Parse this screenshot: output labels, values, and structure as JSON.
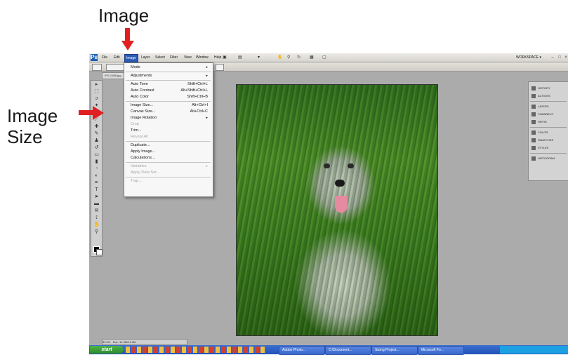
{
  "annotations": {
    "image_label": "Image",
    "image_size_line1": "Image",
    "image_size_line2": "Size",
    "arrow_color": "#e02020"
  },
  "menubar": {
    "logo": "Ps",
    "items": [
      "File",
      "Edit",
      "Image",
      "Layer",
      "Select",
      "Filter",
      "View",
      "Window",
      "Help"
    ],
    "active": "Image",
    "workspace_label": "WORKSPACE ▾"
  },
  "document": {
    "tab_label": "IPG-0456.jpg",
    "zoom": "33.3%",
    "doc_size": "Doc: 12.9M/12.9M"
  },
  "image_menu": [
    {
      "label": "Mode",
      "shortcut": "",
      "submenu": true,
      "disabled": false
    },
    {
      "separator": true
    },
    {
      "label": "Adjustments",
      "shortcut": "",
      "submenu": true,
      "disabled": false
    },
    {
      "separator": true
    },
    {
      "label": "Auto Tone",
      "shortcut": "Shift+Ctrl+L",
      "submenu": false,
      "disabled": false
    },
    {
      "label": "Auto Contrast",
      "shortcut": "Alt+Shift+Ctrl+L",
      "submenu": false,
      "disabled": false
    },
    {
      "label": "Auto Color",
      "shortcut": "Shift+Ctrl+B",
      "submenu": false,
      "disabled": false
    },
    {
      "separator": true
    },
    {
      "label": "Image Size...",
      "shortcut": "Alt+Ctrl+I",
      "submenu": false,
      "disabled": false
    },
    {
      "label": "Canvas Size...",
      "shortcut": "Alt+Ctrl+C",
      "submenu": false,
      "disabled": false
    },
    {
      "label": "Image Rotation",
      "shortcut": "",
      "submenu": true,
      "disabled": false
    },
    {
      "label": "Crop",
      "shortcut": "",
      "submenu": false,
      "disabled": true
    },
    {
      "label": "Trim...",
      "shortcut": "",
      "submenu": false,
      "disabled": false
    },
    {
      "label": "Reveal All",
      "shortcut": "",
      "submenu": false,
      "disabled": true
    },
    {
      "separator": true
    },
    {
      "label": "Duplicate...",
      "shortcut": "",
      "submenu": false,
      "disabled": false
    },
    {
      "label": "Apply Image...",
      "shortcut": "",
      "submenu": false,
      "disabled": false
    },
    {
      "label": "Calculations...",
      "shortcut": "",
      "submenu": false,
      "disabled": false
    },
    {
      "separator": true
    },
    {
      "label": "Variables",
      "shortcut": "",
      "submenu": true,
      "disabled": true
    },
    {
      "label": "Apply Data Set...",
      "shortcut": "",
      "submenu": false,
      "disabled": true
    },
    {
      "separator": true
    },
    {
      "label": "Trap...",
      "shortcut": "",
      "submenu": false,
      "disabled": true
    }
  ],
  "panels": [
    {
      "label": "HISTORY",
      "icon": "history-icon"
    },
    {
      "label": "ACTIONS",
      "icon": "actions-icon"
    },
    {
      "separator": true
    },
    {
      "label": "LAYERS",
      "icon": "layers-icon"
    },
    {
      "label": "CHANNELS",
      "icon": "channels-icon"
    },
    {
      "label": "PATHS",
      "icon": "paths-icon"
    },
    {
      "separator": true
    },
    {
      "label": "COLOR",
      "icon": "color-icon"
    },
    {
      "label": "SWATCHES",
      "icon": "swatches-icon"
    },
    {
      "label": "STYLES",
      "icon": "styles-icon"
    },
    {
      "separator": true
    },
    {
      "label": "HISTOGRAM",
      "icon": "histogram-icon"
    }
  ],
  "taskbar": {
    "start_label": "start",
    "buttons": [
      "Adobe Photo...",
      "C:\\Document...",
      "Sizing Project...",
      "Microsoft Po..."
    ]
  },
  "colors": {
    "menu_highlight": "#2a5bb5",
    "app_bg": "#ababab",
    "taskbar": "#2350b8"
  }
}
